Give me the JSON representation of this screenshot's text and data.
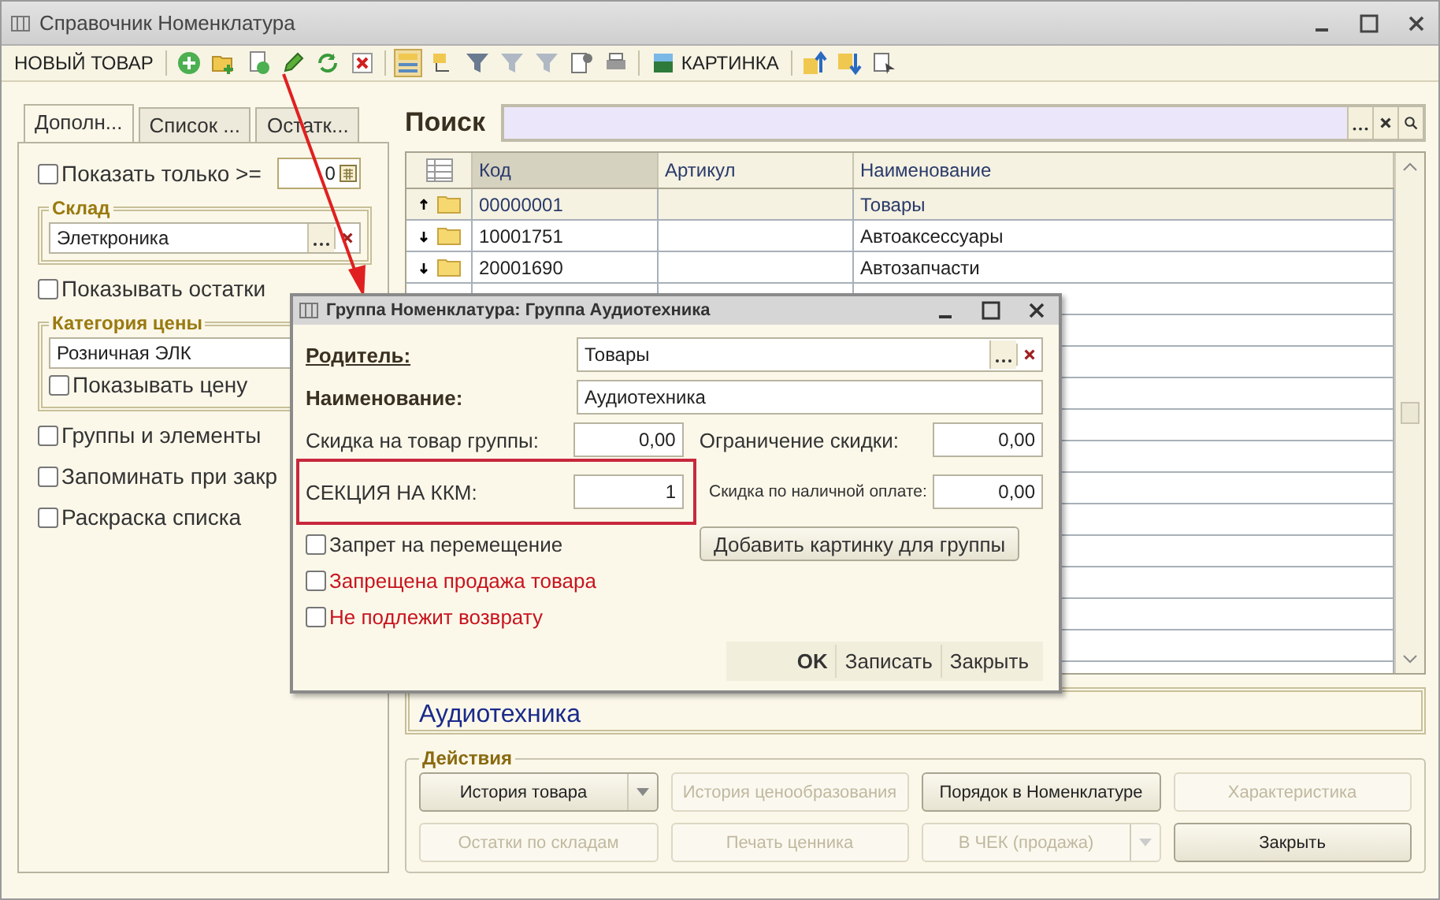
{
  "window": {
    "title": "Справочник Номенклатура"
  },
  "toolbar": {
    "new_button": "НОВЫЙ ТОВАР",
    "picture_button": "КАРТИНКА"
  },
  "left_tabs": [
    {
      "label": "Дополн...",
      "selected": true
    },
    {
      "label": "Список ...",
      "selected": false
    },
    {
      "label": "Остатк...",
      "selected": false
    }
  ],
  "show_only": {
    "label": "Показать только  >=",
    "checked": false,
    "value": "0"
  },
  "warehouse": {
    "title": "Склад",
    "value": "Элеткроника"
  },
  "show_stock": {
    "label": "Показывать остатки",
    "checked": false
  },
  "price_category": {
    "title": "Категория цены",
    "value": "Розничная ЭЛК",
    "show_price": {
      "label": "Показывать цену",
      "checked": false
    }
  },
  "options": [
    {
      "label": "Группы и элементы",
      "checked": false
    },
    {
      "label": "Запоминать при закр",
      "checked": false
    },
    {
      "label": "Раскраска списка",
      "checked": false
    }
  ],
  "search": {
    "label": "Поиск"
  },
  "table": {
    "columns": [
      "Код",
      "Артикул",
      "Наименование"
    ],
    "rows": [
      {
        "code": "00000001",
        "article": "",
        "name": "Товары",
        "selected": true,
        "expanded": true
      },
      {
        "code": "10001751",
        "article": "",
        "name": "Автоаксессуары",
        "selected": false,
        "expanded": false
      },
      {
        "code": "20001690",
        "article": "",
        "name": "Автозапчасти",
        "selected": false,
        "expanded": false
      }
    ]
  },
  "description": "Аудиотехника",
  "actions": {
    "title": "Действия",
    "buttons": [
      {
        "label": "История товара",
        "disabled": false,
        "dropdown": true
      },
      {
        "label": "История ценообразования",
        "disabled": true,
        "dropdown": false
      },
      {
        "label": "Порядок в Номенклатуре",
        "disabled": false,
        "dropdown": false
      },
      {
        "label": "Характеристика",
        "disabled": true,
        "dropdown": false
      },
      {
        "label": "Остатки по складам",
        "disabled": true,
        "dropdown": false
      },
      {
        "label": "Печать ценника",
        "disabled": true,
        "dropdown": false
      },
      {
        "label": "В ЧЕК (продажа)",
        "disabled": true,
        "dropdown": true
      },
      {
        "label": "Закрыть",
        "disabled": false,
        "dropdown": false
      }
    ]
  },
  "dialog": {
    "title": "Группа Номенклатура: Группа Аудиотехника",
    "parent": {
      "label": "Родитель:",
      "value": "Товары"
    },
    "name": {
      "label": "Наименование:",
      "value": "Аудиотехника"
    },
    "discount": {
      "label": "Скидка на товар группы:",
      "value": "0,00"
    },
    "discount_limit": {
      "label": "Ограничение скидки:",
      "value": "0,00"
    },
    "section": {
      "label": "СЕКЦИЯ НА ККМ:",
      "value": "1"
    },
    "cash_discount": {
      "label": "Скидка по наличной оплате:",
      "value": "0,00"
    },
    "add_picture_button": "Добавить картинку для группы",
    "checkboxes": [
      {
        "label": "Запрет на перемещение",
        "checked": false,
        "color": "#333333"
      },
      {
        "label": "Запрещена продажа товара",
        "checked": false,
        "color": "#c8141e"
      },
      {
        "label": "Не подлежит возврату",
        "checked": false,
        "color": "#c8141e"
      }
    ],
    "buttons": [
      {
        "label": "OK",
        "kind": "default"
      },
      {
        "label": "Записать",
        "kind": "normal"
      },
      {
        "label": "Закрыть",
        "kind": "normal"
      }
    ]
  }
}
